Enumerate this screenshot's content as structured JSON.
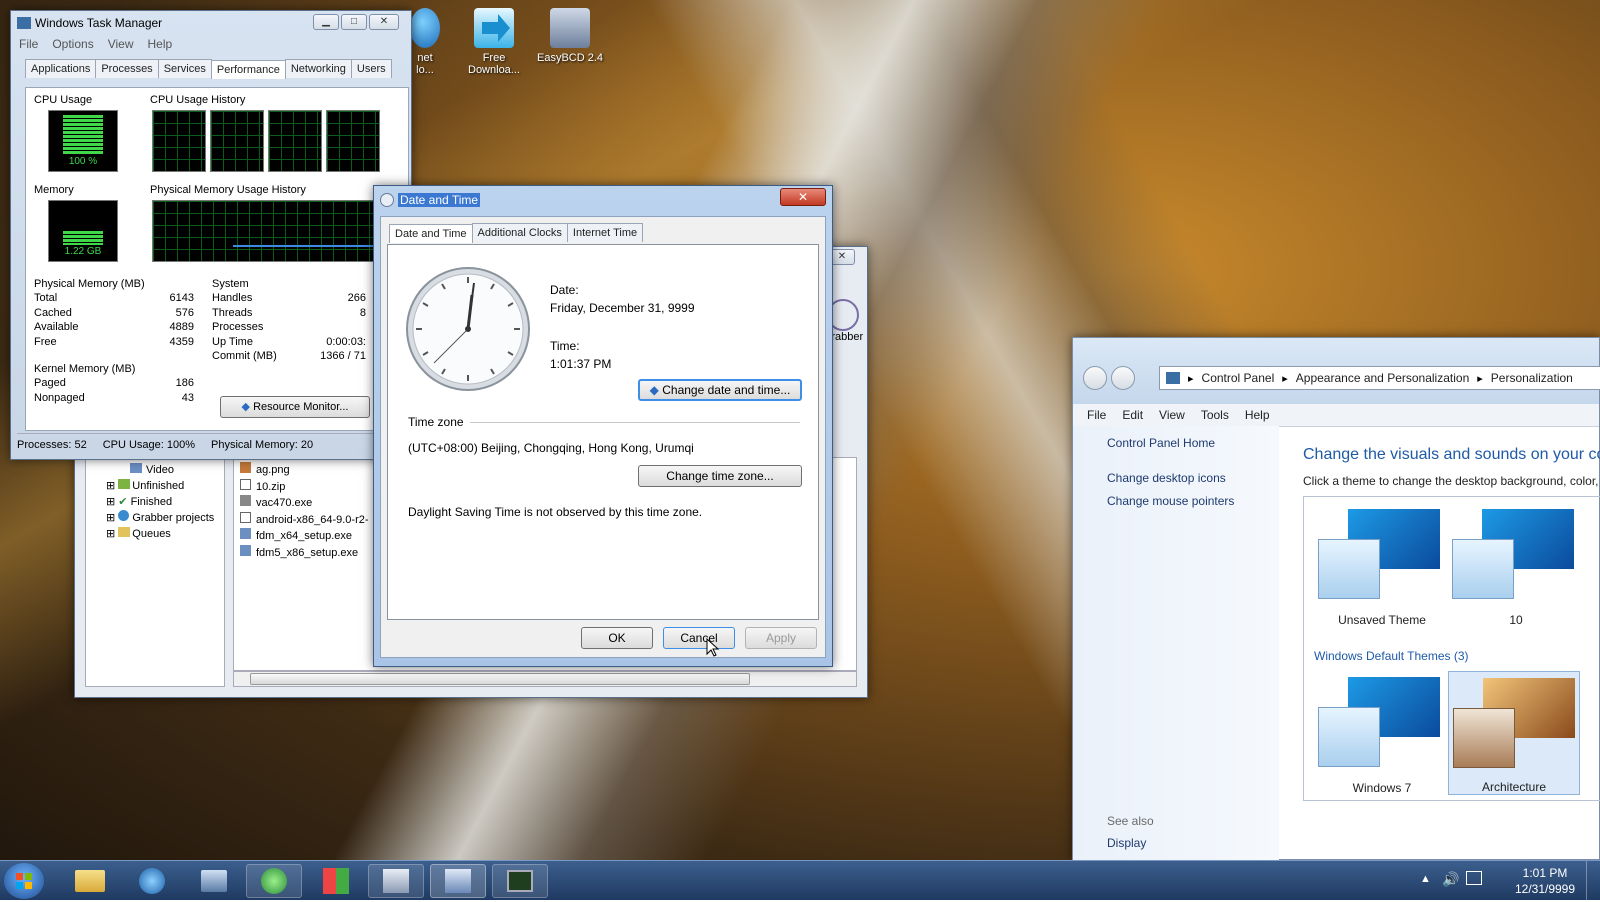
{
  "desktop_icons": [
    {
      "label": "net\nlo..."
    },
    {
      "label": "Free Downloa..."
    },
    {
      "label": "EasyBCD 2.4"
    }
  ],
  "task_manager": {
    "title": "Windows Task Manager",
    "menu": [
      "File",
      "Options",
      "View",
      "Help"
    ],
    "tabs": [
      "Applications",
      "Processes",
      "Services",
      "Performance",
      "Networking",
      "Users"
    ],
    "cpu_usage_label": "CPU Usage",
    "cpu_usage_value": "100 %",
    "cpu_history_label": "CPU Usage History",
    "memory_label": "Memory",
    "memory_value": "1.22 GB",
    "phys_history_label": "Physical Memory Usage History",
    "physical_memory_title": "Physical Memory (MB)",
    "physical_memory": [
      {
        "k": "Total",
        "v": "6143"
      },
      {
        "k": "Cached",
        "v": "576"
      },
      {
        "k": "Available",
        "v": "4889"
      },
      {
        "k": "Free",
        "v": "4359"
      }
    ],
    "system_title": "System",
    "system": [
      {
        "k": "Handles",
        "v": "266"
      },
      {
        "k": "Threads",
        "v": "8"
      },
      {
        "k": "Processes",
        "v": ""
      },
      {
        "k": "Up Time",
        "v": "0:00:03:"
      },
      {
        "k": "Commit (MB)",
        "v": "1366 / 71"
      }
    ],
    "kernel_title": "Kernel Memory (MB)",
    "kernel": [
      {
        "k": "Paged",
        "v": "186"
      },
      {
        "k": "Nonpaged",
        "v": "43"
      }
    ],
    "resource_monitor_label": "Resource Monitor...",
    "status": {
      "processes": "Processes: 52",
      "cpu": "CPU Usage: 100%",
      "mem": "Physical Memory: 20"
    }
  },
  "downloader": {
    "tree": [
      "Video",
      "Unfinished",
      "Finished",
      "Grabber projects",
      "Queues"
    ],
    "files": [
      "ag.png",
      "10.zip",
      "vac470.exe",
      "android-x86_64-9.0-r2-",
      "fdm_x64_setup.exe",
      "fdm5_x86_setup.exe"
    ],
    "grabber_label": "Grabber"
  },
  "date_time": {
    "title": "Date and Time",
    "tabs": [
      "Date and Time",
      "Additional Clocks",
      "Internet Time"
    ],
    "date_label": "Date:",
    "date_value": "Friday, December 31, 9999",
    "time_label": "Time:",
    "time_value": "1:01:37 PM",
    "change_date_label": "Change date and time...",
    "timezone_title": "Time zone",
    "timezone_value": "(UTC+08:00) Beijing, Chongqing, Hong Kong, Urumqi",
    "change_tz_label": "Change time zone...",
    "dst_text": "Daylight Saving Time is not observed by this time zone.",
    "ok": "OK",
    "cancel": "Cancel",
    "apply": "Apply"
  },
  "personalization": {
    "breadcrumb": [
      "Control Panel",
      "Appearance and Personalization",
      "Personalization"
    ],
    "menu": [
      "File",
      "Edit",
      "View",
      "Tools",
      "Help"
    ],
    "sidebar": [
      "Control Panel Home",
      "Change desktop icons",
      "Change mouse pointers"
    ],
    "see_also": "See also",
    "display": "Display",
    "heading": "Change the visuals and sounds on your cor",
    "subheading": "Click a theme to change the desktop background, color,",
    "my_themes": [
      "Unsaved Theme",
      "10"
    ],
    "default_header": "Windows Default Themes (3)",
    "default_themes": [
      "Windows 7",
      "Architecture"
    ]
  },
  "taskbar": {
    "time": "1:01 PM",
    "date": "12/31/9999"
  }
}
